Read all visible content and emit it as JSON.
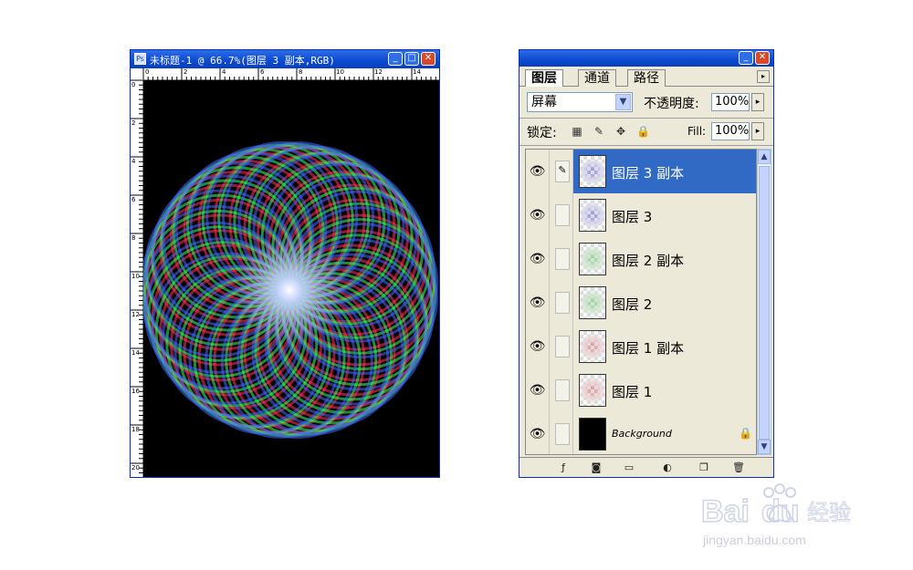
{
  "document": {
    "title": "未标题-1 @ 66.7%(图层 3 副本,RGB)",
    "window_buttons": [
      "minimize",
      "maximize",
      "close"
    ],
    "ruler_top_labels": [
      "0",
      "2",
      "4",
      "6",
      "8",
      "10",
      "12",
      "14"
    ],
    "ruler_left_labels": [
      "0",
      "2",
      "4",
      "6",
      "8",
      "10",
      "12",
      "14",
      "16",
      "18",
      "20"
    ]
  },
  "palette": {
    "tabs": [
      "图层",
      "通道",
      "路径"
    ],
    "active_tab": "图层",
    "blend_mode": "屏幕",
    "opacity_label": "不透明度:",
    "opacity_value": "100%",
    "lock_label": "锁定:",
    "fill_label": "Fill:",
    "fill_value": "100%",
    "layers": [
      {
        "name": "图层 3 副本",
        "selected": true,
        "visible": true,
        "tint": "#8a8ae8"
      },
      {
        "name": "图层 3",
        "selected": false,
        "visible": true,
        "tint": "#8a8ae8"
      },
      {
        "name": "图层 2 副本",
        "selected": false,
        "visible": true,
        "tint": "#7fd77f"
      },
      {
        "name": "图层 2",
        "selected": false,
        "visible": true,
        "tint": "#7fd77f"
      },
      {
        "name": "图层 1 副本",
        "selected": false,
        "visible": true,
        "tint": "#e88a8a"
      },
      {
        "name": "图层 1",
        "selected": false,
        "visible": true,
        "tint": "#e88a8a"
      },
      {
        "name": "Background",
        "selected": false,
        "visible": true,
        "locked": true,
        "tint": "#000000"
      }
    ]
  },
  "watermark": {
    "brand": "Bai经验",
    "site": "jingyan.baidu.com"
  },
  "colors": {
    "xp_title_blue": "#0b4ad0",
    "selection_blue": "#316ac5",
    "palette_bg": "#ece9d8"
  }
}
